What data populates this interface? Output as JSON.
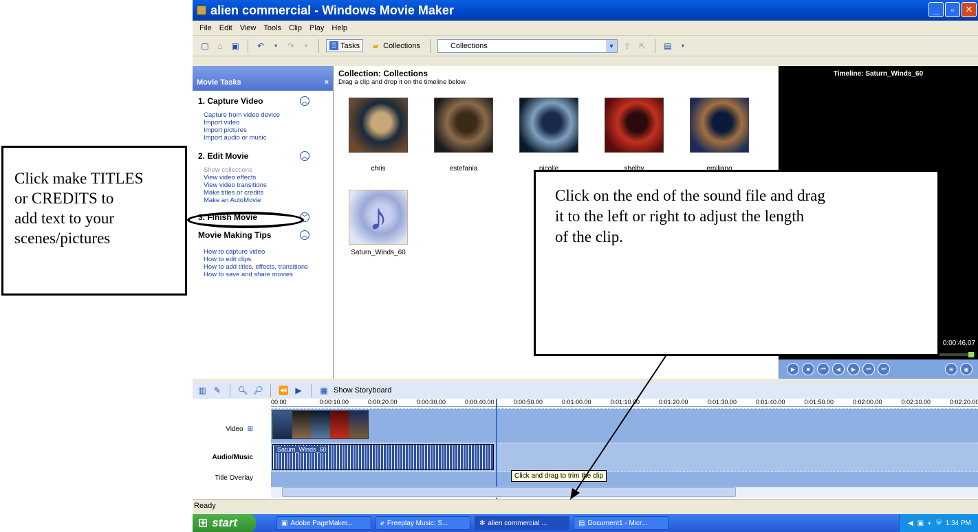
{
  "window": {
    "title": "alien commercial - Windows Movie Maker"
  },
  "menu": [
    "File",
    "Edit",
    "View",
    "Tools",
    "Clip",
    "Play",
    "Help"
  ],
  "toolbar": {
    "tasks_label": "Tasks",
    "collections_label": "Collections",
    "collections_combo_value": "Collections"
  },
  "taskpane": {
    "header": "Movie Tasks",
    "close": "×",
    "sections": [
      {
        "title": "1. Capture Video",
        "links": [
          "Capture from video device",
          "Import video",
          "Import pictures",
          "Import audio or music"
        ]
      },
      {
        "title": "2. Edit Movie",
        "links": [
          "Show collections",
          "View video effects",
          "View video transitions",
          "Make titles or credits",
          "Make an AutoMovie"
        ]
      },
      {
        "title": "3. Finish Movie",
        "links": []
      },
      {
        "title": "Movie Making Tips",
        "links": [
          "How to capture video",
          "How to edit clips",
          "How to add titles, effects, transitions",
          "How to save and share movies"
        ]
      }
    ]
  },
  "collection": {
    "title": "Collection: Collections",
    "subtitle": "Drag a clip and drop it on the timeline below.",
    "items": [
      {
        "name": "chris",
        "colors": [
          "#6b4a2e",
          "#1a2a3a",
          "#c9a878"
        ]
      },
      {
        "name": "estefania",
        "colors": [
          "#1a1a1a",
          "#8a6a4a",
          "#3a2a1a"
        ]
      },
      {
        "name": "nicolle",
        "colors": [
          "#0a1a2a",
          "#7fa0c0",
          "#1a2a4a"
        ]
      },
      {
        "name": "shelby",
        "colors": [
          "#5a0a0a",
          "#c03020",
          "#2a0a0a"
        ]
      },
      {
        "name": "emiliano",
        "colors": [
          "#1a2a5a",
          "#a07040",
          "#0a1a3a"
        ]
      },
      {
        "name": "Saturn_Winds_60",
        "colors": [
          "#dfe6f5",
          "#9aa8d8",
          "#c6d0ee"
        ]
      }
    ]
  },
  "monitor": {
    "title": "Timeline: Saturn_Winds_60",
    "time": "0:00:46.07"
  },
  "timeline": {
    "show_storyboard": "Show Storyboard",
    "ticks": [
      "00:00",
      "0:00:10.00",
      "0:00:20.00",
      "0:00:30.00",
      "0:00:40.00",
      "0:00:50.00",
      "0:01:00.00",
      "0:01:10.00",
      "0:01:20.00",
      "0:01:30.00",
      "0:01:40.00",
      "0:01:50.00",
      "0:02:00.00",
      "0:02:10.00",
      "0:02:20.00"
    ],
    "tracks": {
      "video": "Video",
      "audio": "Audio/Music",
      "title_overlay": "Title Overlay"
    },
    "audio_clip": "Saturn_Winds_60",
    "tooltip": "Click and drag to trim the clip"
  },
  "status": "Ready",
  "taskbar": {
    "start": "start",
    "tasks": [
      "Adobe PageMaker...",
      "Freeplay Music: S...",
      "alien commercial ...",
      "Document1 - Micr..."
    ],
    "clock": "1:34 PM"
  },
  "annotations": {
    "left": [
      "Click make TITLES",
      "or CREDITS to",
      "add text to your",
      "scenes/pictures"
    ],
    "right": [
      "Click on the end of the sound file and drag",
      "it to the left or right to adjust the length",
      "of the clip."
    ]
  }
}
